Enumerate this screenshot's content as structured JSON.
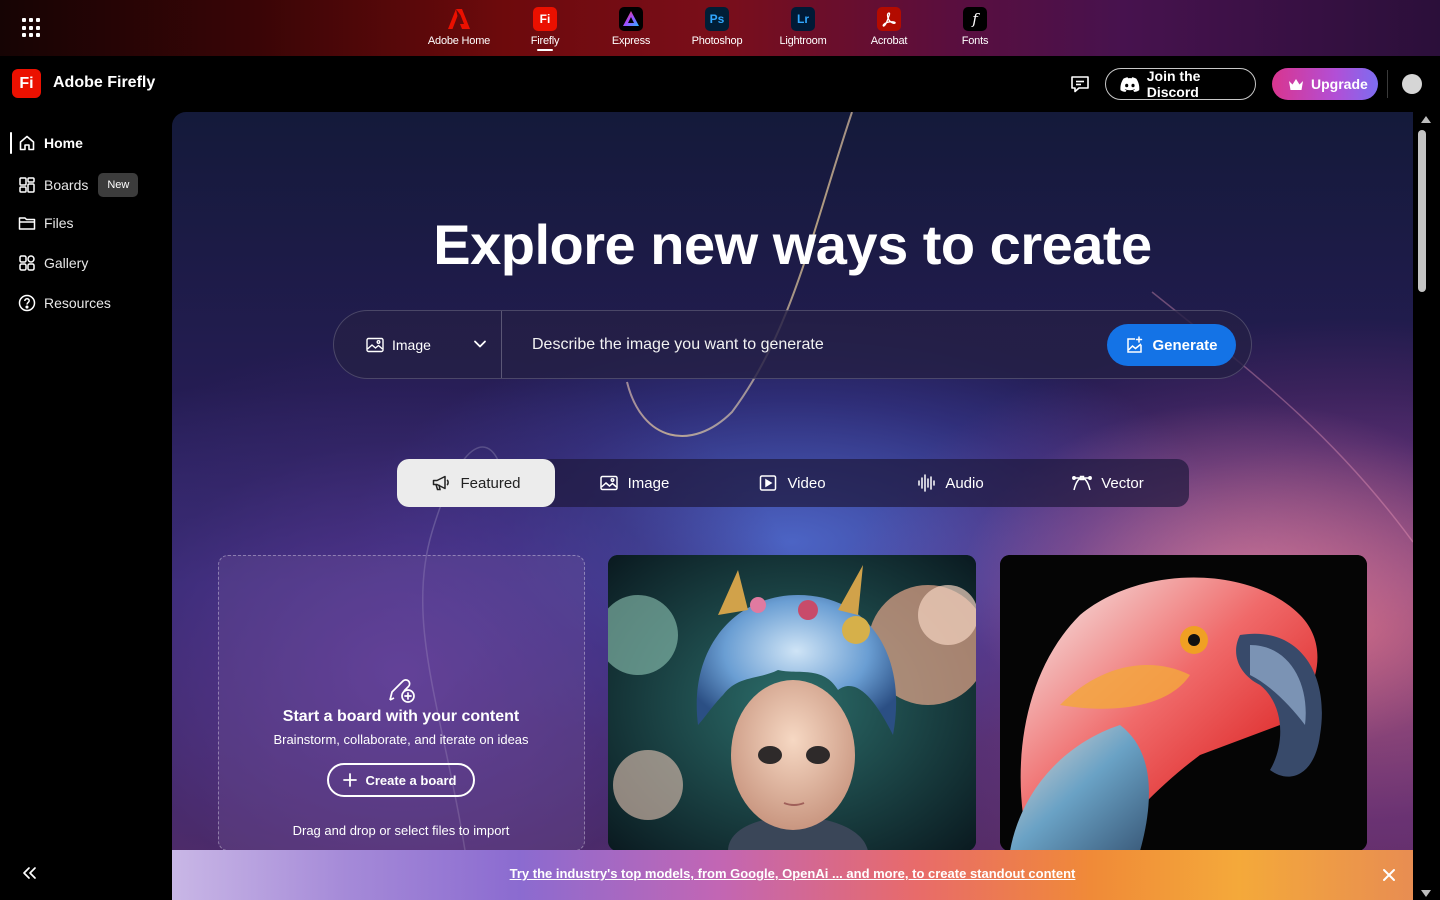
{
  "appbar": {
    "apps": [
      {
        "label": "Adobe Home",
        "badge": "",
        "icon": "adobe-logo-icon",
        "color": "#000000"
      },
      {
        "label": "Firefly",
        "badge": "Fi",
        "icon": "firefly-app-icon",
        "color": "#eb1000"
      },
      {
        "label": "Express",
        "badge": "",
        "icon": "express-app-icon",
        "color": "#000000"
      },
      {
        "label": "Photoshop",
        "badge": "Ps",
        "icon": "photoshop-app-icon",
        "color": "#001e36"
      },
      {
        "label": "Lightroom",
        "badge": "Lr",
        "icon": "lightroom-app-icon",
        "color": "#001a36"
      },
      {
        "label": "Acrobat",
        "badge": "",
        "icon": "acrobat-app-icon",
        "color": "#b30b00"
      },
      {
        "label": "Fonts",
        "badge": "f",
        "icon": "fonts-app-icon",
        "color": "#000000"
      }
    ],
    "active_app": "Firefly"
  },
  "header": {
    "brand_badge": "Fi",
    "brand_name": "Adobe Firefly",
    "discord_label": "Join the Discord",
    "upgrade_label": "Upgrade"
  },
  "sidebar": {
    "items": [
      {
        "label": "Home",
        "icon": "home-icon",
        "active": true
      },
      {
        "label": "Boards",
        "icon": "boards-icon",
        "badge": "New"
      },
      {
        "label": "Files",
        "icon": "folder-icon"
      },
      {
        "label": "Gallery",
        "icon": "gallery-icon"
      },
      {
        "label": "Resources",
        "icon": "help-icon"
      }
    ]
  },
  "main": {
    "hero_title": "Explore new ways to create",
    "prompt": {
      "type_label": "Image",
      "placeholder": "Describe the image you want to generate",
      "generate_label": "Generate"
    },
    "tabs": [
      {
        "label": "Featured",
        "icon": "megaphone-icon",
        "active": true
      },
      {
        "label": "Image",
        "icon": "image-icon"
      },
      {
        "label": "Video",
        "icon": "video-icon"
      },
      {
        "label": "Audio",
        "icon": "audio-wave-icon"
      },
      {
        "label": "Vector",
        "icon": "vector-pen-icon"
      }
    ],
    "board_card": {
      "title": "Start a board with your content",
      "subtitle": "Brainstorm, collaborate, and iterate on ideas",
      "button_label": "Create a board",
      "drop_text": "Drag and drop or select files to import"
    }
  },
  "banner": {
    "text": "Try the industry's top models, from Google, OpenAi ... and more, to create standout content"
  },
  "colors": {
    "accent_blue": "#1473e6",
    "firefly_red": "#eb1000",
    "upgrade_gradient_start": "#d9358f",
    "upgrade_gradient_end": "#7d6cf0"
  }
}
